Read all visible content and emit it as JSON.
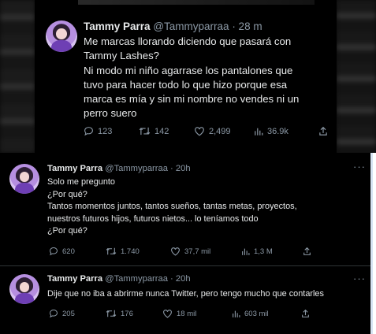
{
  "tweet1": {
    "name": "Tammy Parra",
    "handle": "@Tammyparraa",
    "time": "· 28 m",
    "lines": [
      "Me marcas llorando diciendo que pasará con",
      "Tammy Lashes?",
      "Ni modo mi niño agarrase los pantalones que",
      "tuvo para hacer todo lo que hizo porque esa",
      "marca es mía y sin mi nombre no vendes ni un",
      "perro suero"
    ],
    "replies": "123",
    "retweets": "142",
    "likes": "2,499",
    "views": "36.9k"
  },
  "tweet2": {
    "name": "Tammy Parra",
    "handle": "@Tammyparraa",
    "time": "· 20h",
    "more": "···",
    "lines": [
      "Solo me pregunto",
      "¿Por qué?",
      "Tantos momentos juntos, tantos sueños, tantas metas, proyectos,",
      "nuestros futuros hijos, futuros nietos... lo teníamos todo",
      "¿Por qué?"
    ],
    "replies": "620",
    "retweets": "1.740",
    "likes": "37,7 mil",
    "views": "1,3 M"
  },
  "tweet3": {
    "name": "Tammy Parra",
    "handle": "@Tammyparraa",
    "time": "· 20h",
    "more": "···",
    "lines": [
      "Dije que no iba a abrirme nunca Twitter, pero tengo mucho que contarles"
    ],
    "replies": "205",
    "retweets": "176",
    "likes": "18 mil",
    "views": "603 mil"
  },
  "colors": {
    "background": "#000000",
    "text": "#e7e9ea",
    "muted": "#8b98a5",
    "divider": "#2f3336"
  },
  "icons": [
    "reply-icon",
    "retweet-icon",
    "like-icon",
    "views-icon",
    "share-icon",
    "more-icon"
  ]
}
